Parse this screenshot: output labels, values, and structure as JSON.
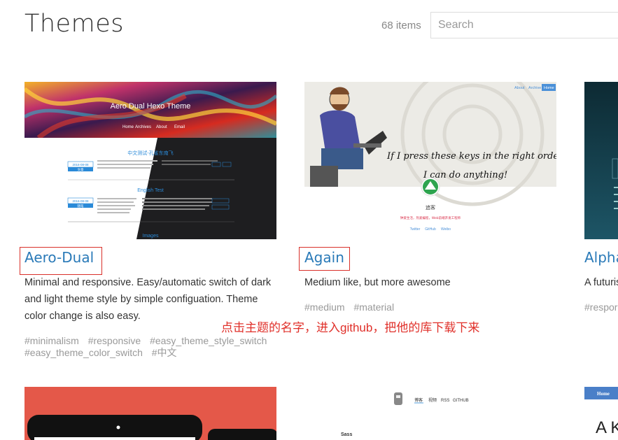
{
  "header": {
    "title": "Themes",
    "count": "68 items",
    "search_placeholder": "Search"
  },
  "cards": [
    {
      "name": "Aero-Dual",
      "description": "Minimal and responsive. Easy/automatic switch of dark and light theme style by simple configuation. Theme color change is also easy.",
      "tags": [
        "#minimalism",
        "#responsive",
        "#easy_theme_style_switch",
        "#easy_theme_color_switch",
        "#中文"
      ],
      "preview": {
        "banner_title": "Aero Dual Hexo Theme",
        "nav": [
          "Home",
          "Archives",
          "About",
          "Email"
        ],
        "heading_cn": "中文测试-孔雀东南飞",
        "heading_en": "English Test",
        "heading_img": "Images",
        "date1": "2016-08-08",
        "date2": "2016-08-08",
        "tag1": "文章",
        "tag2": "随笔",
        "lorem": "Lorem ipsum dolor sit amet consectetur adipiscing elit. Pellentesque vehicula tellus in laoreet tincidunt. Aliquam erat volutpat.",
        "cn_text": "汉末建安中，庐江府小吏焦仲卿妻刘氏，为仲卿母所遣，自誓不嫁。其家逼之，乃投水而死。"
      }
    },
    {
      "name": "Again",
      "description": "Medium like, but more awesome",
      "tags": [
        "#medium",
        "#material"
      ],
      "preview": {
        "nav": [
          "About",
          "Archive",
          "Home"
        ],
        "quote_line1": "If I press these keys in the right order,",
        "quote_line2": "I can do anything!",
        "author": "追客",
        "subtitle": "钟爱生活，热爱编程，Web前端开发工程师",
        "links": [
          "Twitter",
          "GitHub",
          "Weibo"
        ]
      }
    },
    {
      "name": "Alpha",
      "description": "A futuris",
      "tags": [
        "#respor"
      ]
    }
  ],
  "row2": {
    "preview2_nav": [
      "博客",
      "视频",
      "RSS",
      "GITHUB"
    ],
    "preview2_label": "Sass",
    "preview3_nav": "Home",
    "preview3_text": "A K"
  },
  "annotation": "点击主题的名字，进入github，把他的库下载下来"
}
